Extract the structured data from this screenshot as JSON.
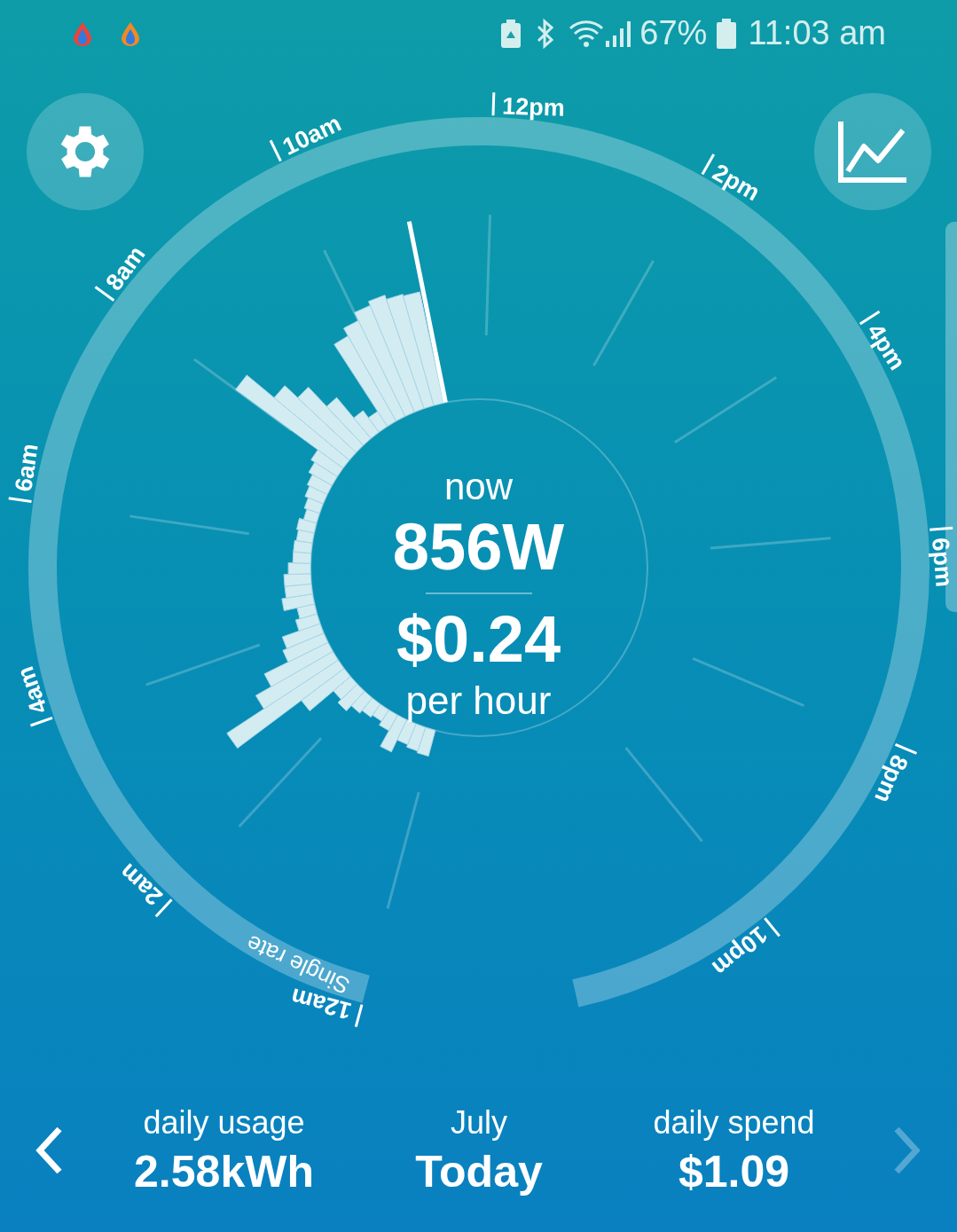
{
  "status_bar": {
    "battery": "67%",
    "time": "11:03 am"
  },
  "dial": {
    "hour_labels": [
      "12am",
      "2am",
      "4am",
      "6am",
      "8am",
      "10am",
      "12pm",
      "2pm",
      "4pm",
      "6pm",
      "8pm",
      "10pm"
    ],
    "tariff": "Single rate",
    "now": {
      "label": "now",
      "power": "856W",
      "cost": "$0.24",
      "unit": "per hour"
    }
  },
  "summary": {
    "usage": {
      "label": "daily usage",
      "value": "2.58kWh"
    },
    "period": {
      "label": "July",
      "value": "Today"
    },
    "spend": {
      "label": "daily spend",
      "value": "$1.09"
    }
  },
  "nav": {
    "previous": {
      "disabled": false
    },
    "next": {
      "disabled": true
    }
  }
}
